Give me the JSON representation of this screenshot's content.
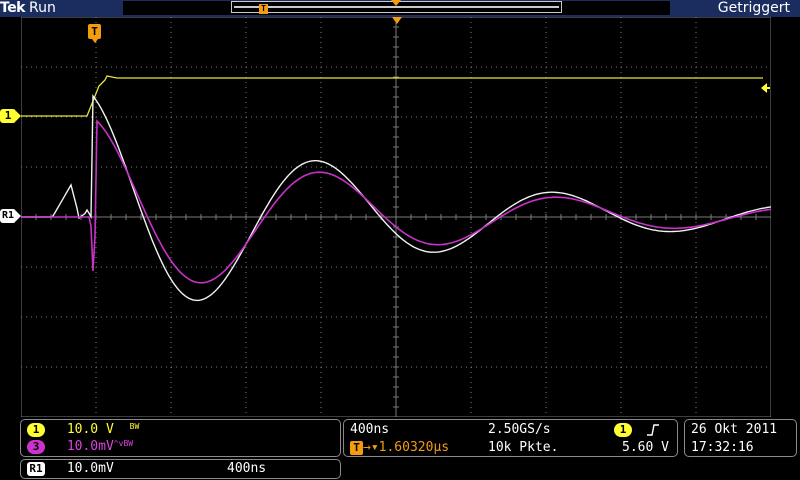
{
  "topbar": {
    "brand": "Tek",
    "run_state": "Run",
    "trigger_status": "Getriggert",
    "trigger_marker": "T"
  },
  "markers": {
    "ch1": "1",
    "ref1": "R1",
    "trigger": "T"
  },
  "channels": {
    "ch1": {
      "badge": "1",
      "scale": "10.0 V",
      "bw": "BW",
      "color": "#ffff33"
    },
    "ch3": {
      "badge": "3",
      "scale": "10.0mV",
      "suffix": "^v",
      "bw": "BW",
      "color": "#cc33cc"
    }
  },
  "reference": {
    "badge": "R1",
    "scale": "10.0mV",
    "timebase": "400ns"
  },
  "acquisition": {
    "timebase": "400ns",
    "sample_rate": "2.50GS/s",
    "trigger_delay": "1.60320µs",
    "record_length": "10k Pkte.",
    "trigger_source_badge": "1",
    "trigger_slope": "rising",
    "trigger_level": "5.60 V"
  },
  "datetime": {
    "date": "26 Okt  2011",
    "time": "17:32:16"
  },
  "colors": {
    "ch1": "#ffff33",
    "ch3": "#cc33cc",
    "ref": "#ffffff",
    "accent": "#f39c12",
    "topbar": "#1a2d5e"
  }
}
